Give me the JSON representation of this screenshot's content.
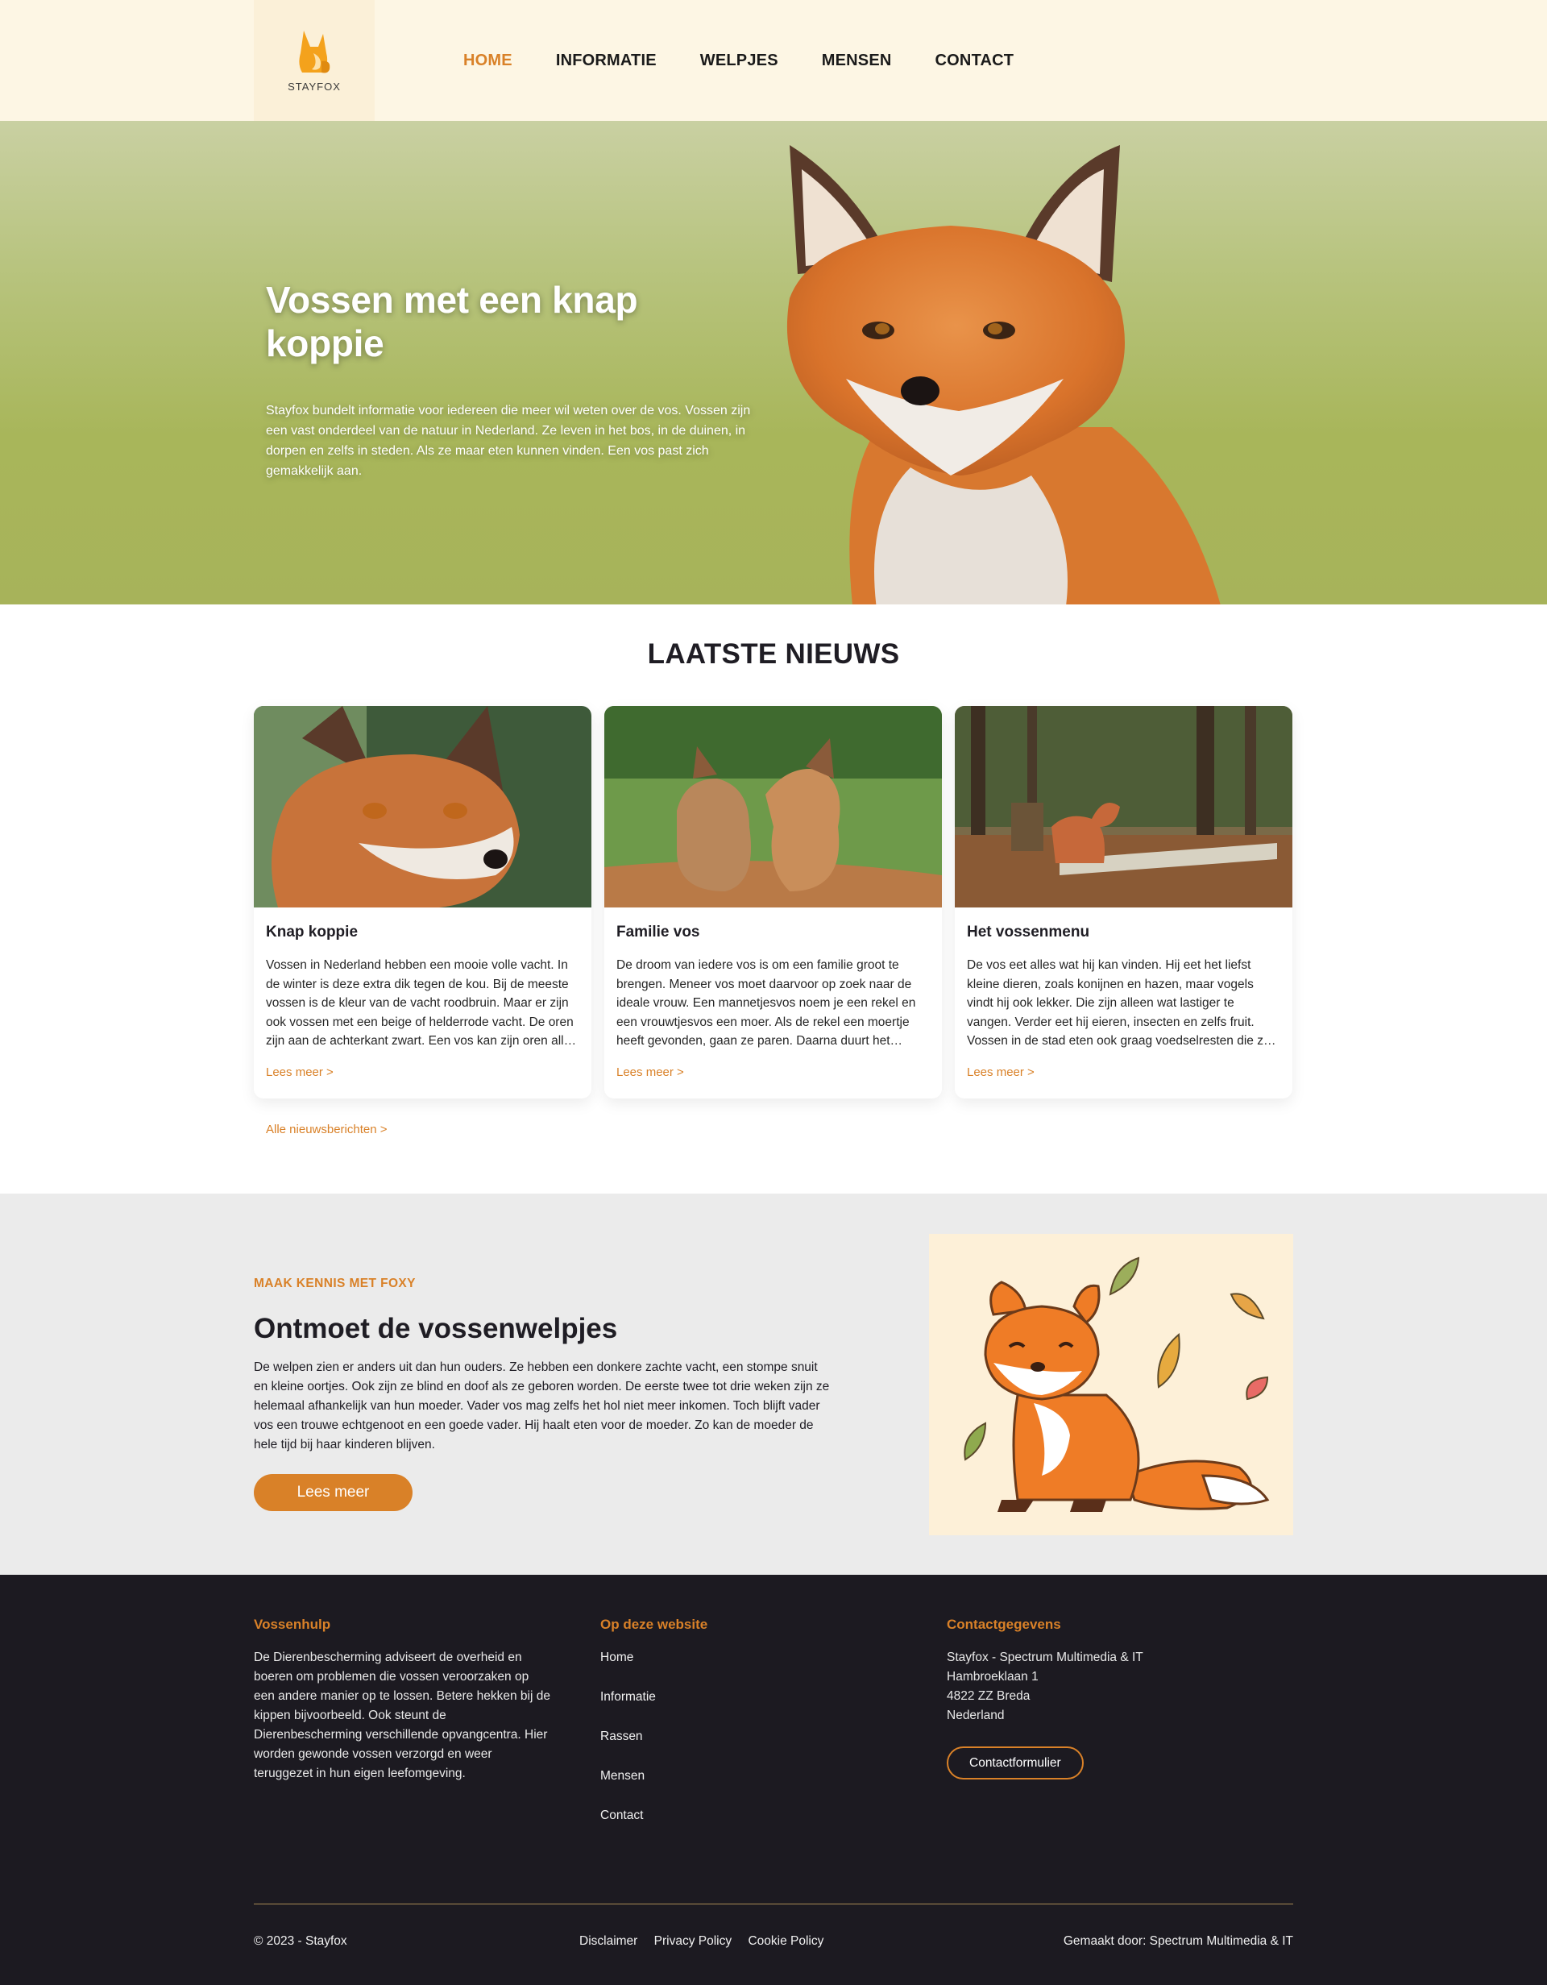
{
  "brand": {
    "name": "STAYFOX",
    "accent": "#d98128",
    "dark": "#1c1a21"
  },
  "nav": [
    {
      "label": "HOME",
      "active": true
    },
    {
      "label": "INFORMATIE",
      "active": false
    },
    {
      "label": "WELPJES",
      "active": false
    },
    {
      "label": "MENSEN",
      "active": false
    },
    {
      "label": "CONTACT",
      "active": false
    }
  ],
  "hero": {
    "title": "Vossen met een knap koppie",
    "text": "Stayfox bundelt informatie voor iedereen die meer wil weten over de vos. Vossen zijn een vast onderdeel van de natuur in Nederland. Ze leven in het bos, in de duinen, in dorpen en zelfs in steden. Als ze maar eten kunnen vinden. Een vos past zich gemakkelijk aan."
  },
  "news": {
    "title": "LAATSTE NIEUWS",
    "cards": [
      {
        "title": "Knap koppie",
        "text": "Vossen in Nederland hebben een mooie volle vacht. In de winter is deze extra dik tegen de kou. Bij de meeste vossen is de kleur van de vacht roodbruin. Maar er zijn ook vossen met een beige of helderrode vacht. De oren zijn aan de achterkant zwart. Een vos kan zijn oren all…",
        "link": "Lees meer  >"
      },
      {
        "title": "Familie vos",
        "text": "De droom van iedere vos is om een familie groot te brengen. Meneer vos moet daarvoor op zoek naar de ideale vrouw. Een mannetjesvos noem je een rekel en een vrouwtjesvos een moer. Als de rekel een moertje heeft gevonden, gaan ze paren. Daarna duurt het…",
        "link": "Lees meer  >"
      },
      {
        "title": "Het vossenmenu",
        "text": "De vos eet alles wat hij kan vinden. Hij eet het liefst kleine dieren, zoals konijnen en hazen, maar vogels vindt hij ook lekker. Die zijn alleen wat lastiger te vangen. Verder eet hij eieren, insecten en zelfs fruit. Vossen in de stad eten ook graag voedselresten die z…",
        "link": "Lees meer  >"
      }
    ],
    "all_link": "Alle nieuwsberichten  >"
  },
  "meet": {
    "eyebrow": "MAAK KENNIS MET FOXY",
    "title": "Ontmoet de vossenwelpjes",
    "text": "De welpen zien er anders uit dan hun ouders. Ze hebben een donkere zachte vacht, een stompe snuit en kleine oortjes. Ook zijn ze blind en doof als ze geboren worden. De eerste twee tot drie weken zijn ze helemaal afhankelijk van hun moeder. Vader vos mag zelfs het hol niet meer inkomen. Toch blijft vader vos een trouwe echtgenoot en een goede vader. Hij haalt eten voor de moeder. Zo kan de moeder de hele tijd bij haar kinderen blijven.",
    "button": "Lees meer"
  },
  "footer": {
    "col1": {
      "title": "Vossenhulp",
      "text": "De Dierenbescherming adviseert de overheid en boeren om problemen die vossen veroorzaken op een andere manier op te lossen. Betere hekken bij de kippen bijvoorbeeld. Ook steunt de Dierenbescherming verschillende opvangcentra. Hier worden gewonde vossen verzorgd en weer teruggezet in hun eigen leefomgeving."
    },
    "col2": {
      "title": "Op deze website",
      "links": [
        "Home",
        "Informatie",
        "Rassen",
        "Mensen",
        "Contact"
      ]
    },
    "col3": {
      "title": "Contactgegevens",
      "lines": [
        "Stayfox - Spectrum Multimedia & IT",
        "Hambroeklaan 1",
        "4822 ZZ Breda",
        "Nederland"
      ],
      "button": "Contactformulier"
    },
    "copyright": "© 2023 - Stayfox",
    "legal": [
      "Disclaimer",
      "Privacy Policy",
      "Cookie Policy"
    ],
    "made_by": "Gemaakt door: Spectrum Multimedia & IT"
  },
  "icons": [
    "fox-logo-icon",
    "chevron-right-icon"
  ]
}
